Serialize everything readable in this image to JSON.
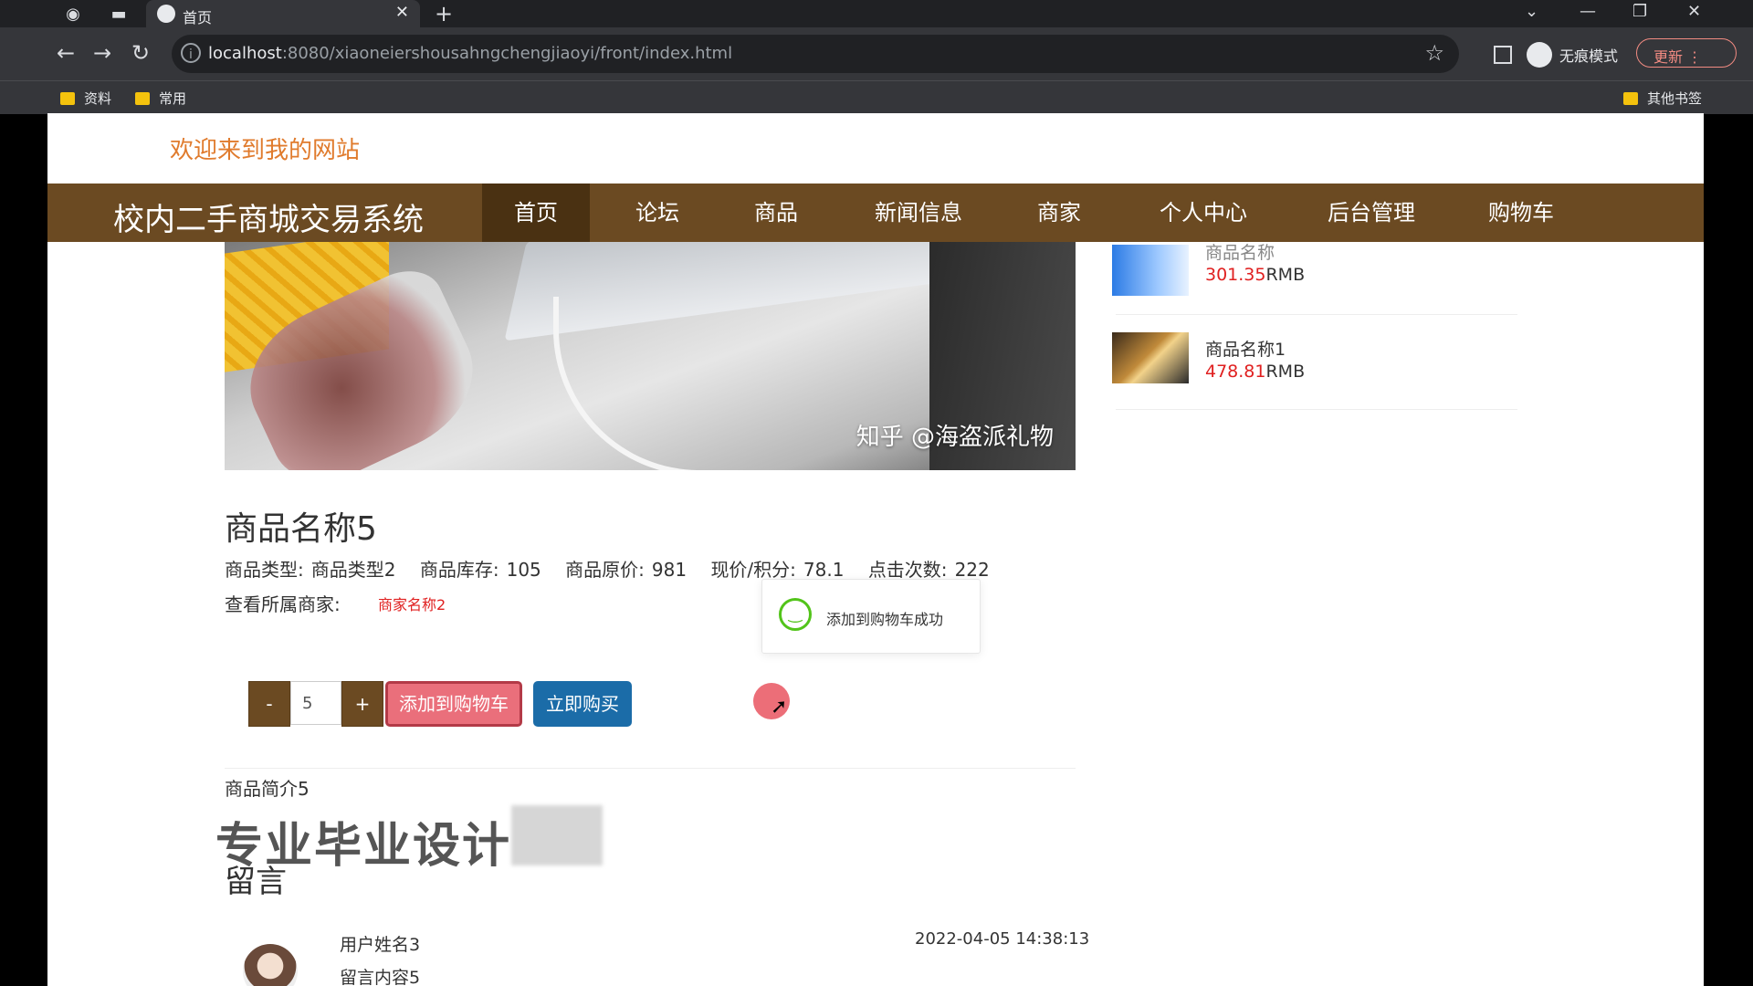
{
  "browser": {
    "tab_title": "首页",
    "url_host": "localhost",
    "url_path": ":8080/xiaoneiershousahngchengjiaoyi/front/index.html",
    "incognito_label": "无痕模式",
    "update_label": "更新",
    "bookmarks": [
      "资料",
      "常用"
    ],
    "other_bookmarks": "其他书签"
  },
  "site": {
    "welcome": "欢迎来到我的网站",
    "brand": "校内二手商城交易系统",
    "nav": [
      "首页",
      "论坛",
      "商品",
      "新闻信息",
      "商家",
      "个人中心",
      "后台管理",
      "购物车"
    ]
  },
  "product": {
    "watermark": "知乎 @海盗派礼物",
    "name": "商品名称5",
    "meta": [
      {
        "label": "商品类型:",
        "value": "商品类型2"
      },
      {
        "label": "商品库存:",
        "value": "105"
      },
      {
        "label": "商品原价:",
        "value": "981"
      },
      {
        "label": "现价/积分:",
        "value": "78.1"
      },
      {
        "label": "点击次数:",
        "value": "222"
      }
    ],
    "merchant_label": "查看所属商家:",
    "merchant_name": "商家名称2",
    "quantity": "5",
    "minus": "-",
    "plus": "+",
    "add_to_cart": "添加到购物车",
    "buy_now": "立即购买",
    "intro": "商品简介5"
  },
  "toast": {
    "message": "添加到购物车成功"
  },
  "promo_text": "专业毕业设计",
  "comments": {
    "title": "留言",
    "items": [
      {
        "user": "用户姓名3",
        "content": "留言内容5",
        "date": "2022-04-05 14:38:13"
      }
    ]
  },
  "recommend": [
    {
      "name": "商品名称",
      "price": "301.35",
      "unit": "RMB"
    },
    {
      "name": "商品名称1",
      "price": "478.81",
      "unit": "RMB"
    }
  ]
}
